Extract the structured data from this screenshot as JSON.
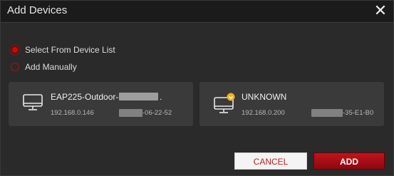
{
  "dialog": {
    "title": "Add Devices",
    "close_glyph": "✕"
  },
  "options": {
    "select_from_list": {
      "label": "Select From Device List",
      "checked": true
    },
    "add_manually": {
      "label": "Add Manually",
      "checked": false
    }
  },
  "devices": [
    {
      "name": "EAP225-Outdoor-",
      "name_suffix": ".",
      "ip": "192.168.0.146",
      "mac_visible": "-06-22-52",
      "icon": "monitor-icon",
      "badge": null
    },
    {
      "name": "UNKNOWN",
      "ip": "192.168.0.200",
      "mac_visible": "-35-E1-B0",
      "icon": "monitor-icon",
      "badge": "warning-badge-icon"
    }
  ],
  "buttons": {
    "cancel": "CANCEL",
    "add": "ADD"
  },
  "colors": {
    "accent_red": "#c4121b",
    "badge_yellow": "#f2b01e"
  }
}
